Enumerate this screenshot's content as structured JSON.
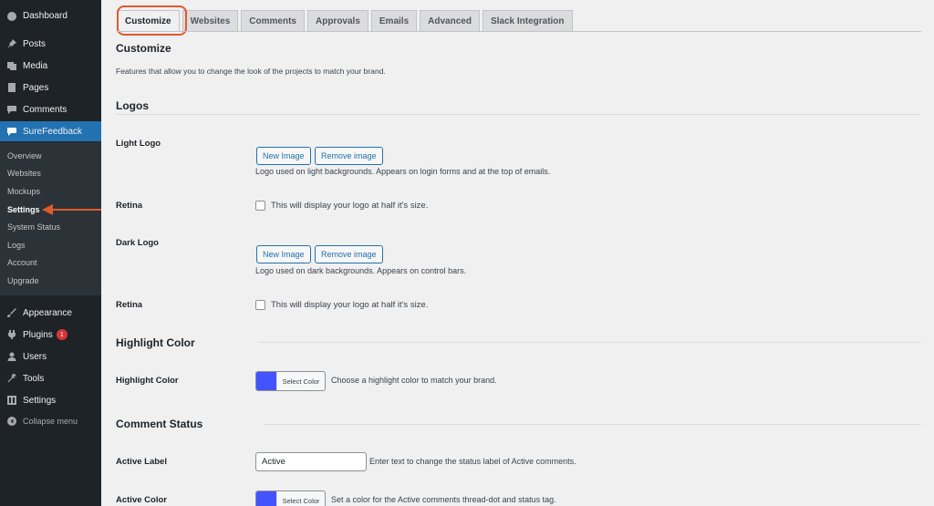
{
  "sidebar": {
    "items": [
      {
        "label": "Dashboard",
        "icon": "dashboard-icon"
      },
      {
        "label": "Posts",
        "icon": "pin-icon"
      },
      {
        "label": "Media",
        "icon": "media-icon"
      },
      {
        "label": "Pages",
        "icon": "page-icon"
      },
      {
        "label": "Comments",
        "icon": "comment-icon"
      },
      {
        "label": "SureFeedback",
        "icon": "feedback-icon"
      }
    ],
    "submenu": [
      "Overview",
      "Websites",
      "Mockups",
      "Settings",
      "System Status",
      "Logs",
      "Account",
      "Upgrade"
    ],
    "lower_items": [
      {
        "label": "Appearance",
        "icon": "brush-icon"
      },
      {
        "label": "Plugins",
        "icon": "plugin-icon",
        "badge": "1"
      },
      {
        "label": "Users",
        "icon": "user-icon"
      },
      {
        "label": "Tools",
        "icon": "wrench-icon"
      },
      {
        "label": "Settings",
        "icon": "settings-icon"
      }
    ],
    "collapse": "Collapse menu"
  },
  "tabs": [
    "Customize",
    "Websites",
    "Comments",
    "Approvals",
    "Emails",
    "Advanced",
    "Slack Integration"
  ],
  "customize": {
    "title": "Customize",
    "description": "Features that allow you to change the look of the projects to match your brand."
  },
  "logos": {
    "title": "Logos",
    "light_logo": "Light Logo",
    "new_image": "New Image",
    "remove_image": "Remove image",
    "light_help": "Logo used on light backgrounds. Appears on login forms and at the top of emails.",
    "retina": "Retina",
    "retina_label": "This will display your logo at half it's size.",
    "dark_logo": "Dark Logo",
    "dark_help": "Logo used on dark backgrounds. Appears on control bars."
  },
  "highlight": {
    "title": "Highlight Color",
    "label": "Highlight Color",
    "select_color": "Select Color",
    "help": "Choose a highlight color to match your brand.",
    "color": "#4353ff"
  },
  "comment_status": {
    "title": "Comment Status",
    "active_label": "Active Label",
    "active_value": "Active",
    "active_help": "Enter text to change the status label of Active comments.",
    "active_color": "Active Color",
    "select_color": "Select Color",
    "active_color_help": "Set a color for the Active comments thread-dot and status tag.",
    "color": "#4353ff"
  }
}
